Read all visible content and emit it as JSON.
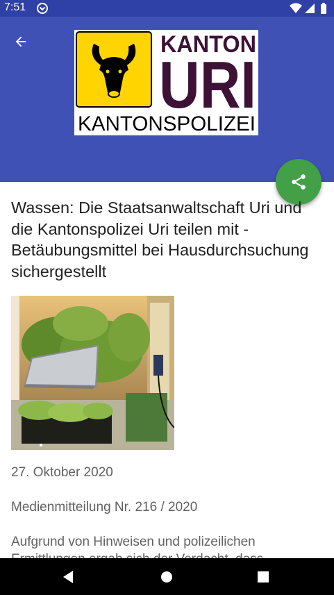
{
  "status_bar": {
    "time": "7:51",
    "icons": [
      "app-notification-icon",
      "wifi-icon",
      "signal-icon",
      "battery-icon"
    ]
  },
  "app_bar": {
    "background": "#3f51b5",
    "back_icon": "arrow-back-icon",
    "logo": {
      "text_top": "KANTON",
      "text_main": "URI",
      "text_bottom": "KANTONSPOLIZEI",
      "shield_color": "#ffd400",
      "text_color": "#3d1236"
    }
  },
  "share_button": {
    "icon": "share-icon",
    "color": "#43a047"
  },
  "article": {
    "title": "Wassen: Die Staatsanwaltschaft Uri und die Kantonspolizei Uri teilen mit - Betäubungsmittel bei Hausdurchsuchung sichergestellt",
    "date": "27. Oktober 2020",
    "press_release_number": "Medienmitteilung Nr. 216 / 2020",
    "body_start": "Aufgrund von Hinweisen und polizeilichen Ermittlungen ergab sich der Verdacht, dass"
  },
  "nav_bar": {
    "icons": [
      "nav-back-icon",
      "nav-home-icon",
      "nav-recents-icon"
    ]
  }
}
